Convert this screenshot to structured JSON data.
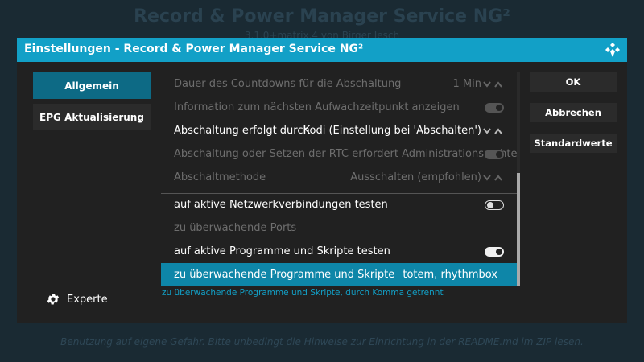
{
  "background": {
    "title": "Record & Power Manager Service NG²",
    "subtitle": "3.1.0+matrix.4 von Birger Jesch",
    "footer": "Benutzung auf eigene Gefahr. Bitte unbedingt die Hinweise zur Einrichtung in der README.md im ZIP lesen."
  },
  "dialog": {
    "title": "Einstellungen - Record & Power Manager Service NG²",
    "app_icon": "kodi-logo-icon"
  },
  "sidebar": {
    "items": [
      {
        "label": "Allgemein",
        "active": true
      },
      {
        "label": "EPG Aktualisierung",
        "active": false
      }
    ],
    "expert_label": "Experte",
    "expert_icon": "gear-icon"
  },
  "settings": [
    {
      "label": "Dauer des Countdowns für die Abschaltung",
      "value": "1 Min",
      "control": "arrows",
      "enabled": false
    },
    {
      "label": "Information zum nächsten Aufwachzeitpunkt anzeigen",
      "value": "",
      "control": "toggle-on",
      "enabled": false
    },
    {
      "label": "Abschaltung erfolgt durch",
      "value": "Kodi (Einstellung bei 'Abschalten')",
      "control": "arrows",
      "enabled": true
    },
    {
      "label": "Abschaltung oder Setzen der RTC erfordert Administrationsrechte",
      "value": "",
      "control": "toggle-on",
      "enabled": false
    },
    {
      "label": "Abschaltmethode",
      "value": "Ausschalten (empfohlen)",
      "control": "arrows",
      "enabled": false
    },
    {
      "label": "auf aktive Netzwerkverbindungen testen",
      "value": "",
      "control": "toggle-off",
      "enabled": true
    },
    {
      "label": "zu überwachende Ports",
      "value": "",
      "control": "none",
      "enabled": false
    },
    {
      "label": "auf aktive Programme und Skripte testen",
      "value": "",
      "control": "toggle-on",
      "enabled": true
    },
    {
      "label": "zu überwachende Programme und Skripte",
      "value": "totem, rhythmbox",
      "control": "none",
      "enabled": true,
      "selected": true
    }
  ],
  "hint": "zu überwachende Programme und Skripte, durch Komma getrennt",
  "buttons": {
    "ok": "OK",
    "cancel": "Abbrechen",
    "defaults": "Standardwerte"
  },
  "colors": {
    "accent": "#12a0c7",
    "selected_row": "#0e86a8",
    "active_tab": "#0d6a85",
    "dialog_bg": "#212121",
    "page_bg": "#1a2a33"
  }
}
